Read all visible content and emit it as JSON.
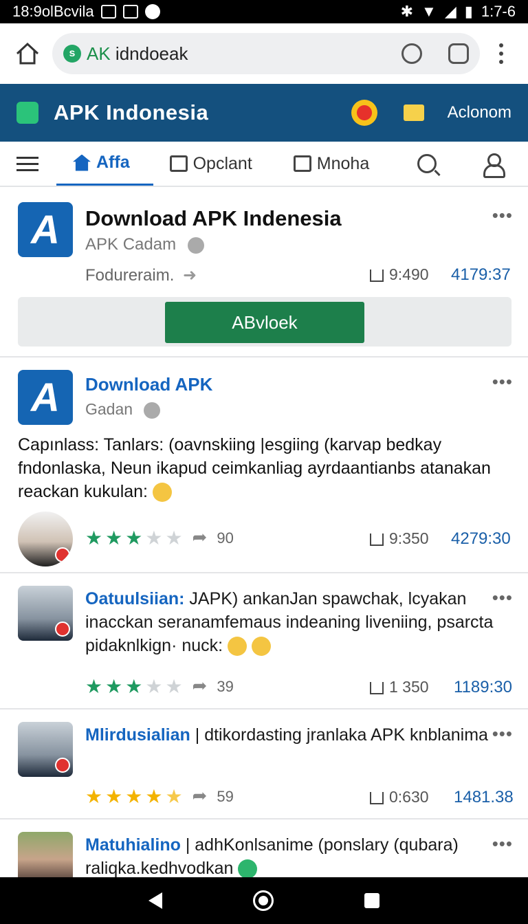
{
  "status_bar": {
    "time_left": "18:9olBcvila",
    "time_right": "1:7-6"
  },
  "browser": {
    "url_prefix": "AK",
    "url_rest": " idndoeak"
  },
  "app_bar": {
    "title": "APK  Indonesia",
    "action": "Aclonom"
  },
  "tabs": [
    {
      "label": "Affa"
    },
    {
      "label": "Opclant"
    },
    {
      "label": "Mnoha"
    }
  ],
  "featured": {
    "title": "Download APK Indenesia",
    "subtitle": "APK  Cadam",
    "link": "Fodureraim.",
    "count": "9:490",
    "number": "4179:37",
    "button": "ABvloek"
  },
  "post_card": {
    "title": "Download APK",
    "subtitle": "Gadan",
    "body": "Capınlass: Tanlars: (oavnskiing |esgiing (karvap bedkay fndonlaska, Neun ikapud ceimkanliag ayrdaantianbs atanakan reackan kukulan:",
    "rating": 3,
    "votes": "90",
    "count": "9:350",
    "number": "4279:30"
  },
  "comments": [
    {
      "author": "Oatuulsiian:",
      "text": " JAPK) ankanJan spawchak, lcyakan inacckan seranamfemaus indeaning liveniing, psarcta pidaknlkign· nuck:",
      "rating": 3,
      "votes": "39",
      "count": "1 350",
      "number": "1189:30"
    },
    {
      "author": "Mlirdusialian",
      "text": " | dtikordasting  jranlaka APK knblanima",
      "rating": 4.5,
      "votes": "59",
      "count": "0:630",
      "number": "1481.38"
    },
    {
      "author": "Matuhialino",
      "text": " | adhKonlsanime (ponslary (qubara) raliqka.kedhvodkan"
    }
  ]
}
